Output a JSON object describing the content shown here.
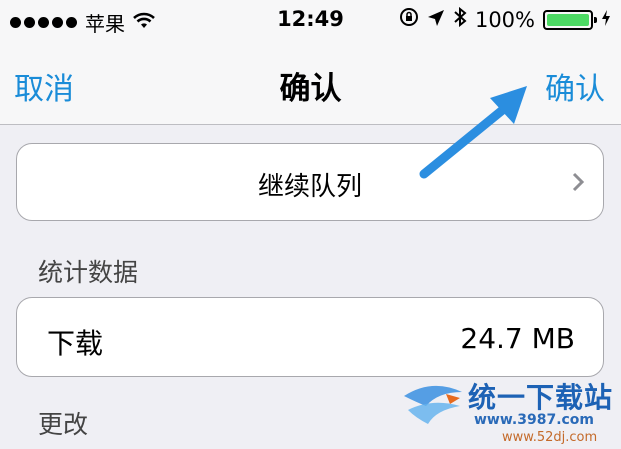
{
  "status_bar": {
    "carrier": "苹果",
    "time": "12:49",
    "battery_percent": "100%"
  },
  "nav": {
    "cancel": "取消",
    "title": "确认",
    "confirm": "确认"
  },
  "queue": {
    "label": "继续队列"
  },
  "stats": {
    "header": "统计数据",
    "downloads_label": "下载",
    "downloads_value": "24.7 MB"
  },
  "changes": {
    "header": "更改"
  },
  "watermark": {
    "brand": "统一下载站",
    "site": "www.3987.com",
    "site2": "www.52dj.com"
  },
  "colors": {
    "accent": "#1a8cd8",
    "battery": "#4cd964",
    "annotation_arrow": "#2b8ee0"
  }
}
